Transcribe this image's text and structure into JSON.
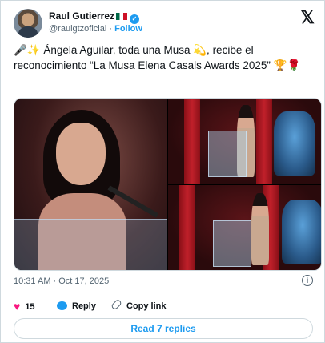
{
  "author": {
    "name": "Raul Gutierrez",
    "flag": "🇲🇽",
    "handle": "@raulgtzoficial",
    "separator": "·",
    "follow_label": "Follow"
  },
  "logo": "𝕏",
  "tweet": {
    "text": "🎤✨ Ángela Aguilar, toda una Musa 💫, recibe el reconocimiento “La Musa Elena Casals Awards 2025” 🏆🌹"
  },
  "meta": {
    "timestamp": "10:31 AM · Oct 17, 2025"
  },
  "actions": {
    "likes_count": "15",
    "reply_label": "Reply",
    "copy_link_label": "Copy link"
  },
  "read_replies_label": "Read 7 replies",
  "colors": {
    "accent": "#1d9bf0",
    "like": "#f91880",
    "muted": "#536471",
    "text": "#0f1419"
  }
}
